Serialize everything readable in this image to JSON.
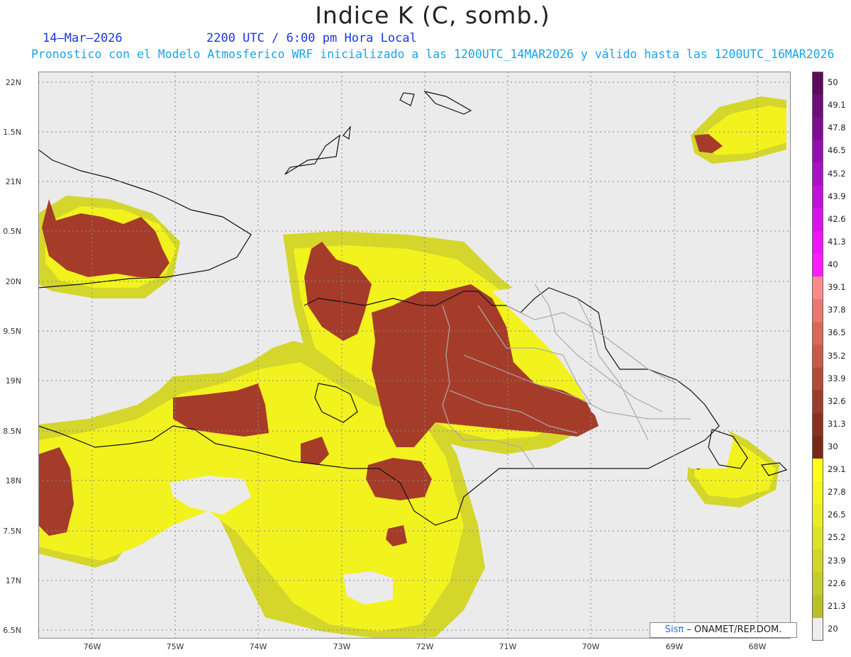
{
  "header": {
    "title": "Indice K (C, somb.)",
    "date": "14–Mar–2026",
    "time_label": "2200 UTC / 6:00 pm Hora Local",
    "subtitle": "Pronostico con el Modelo Atmosferico WRF inicializado a las 1200UTC_14MAR2026 y válido hasta las  1200UTC_16MAR2026"
  },
  "lat_labels": [
    "22N",
    "1.5N",
    "21N",
    "0.5N",
    "20N",
    "9.5N",
    "19N",
    "8.5N",
    "18N",
    "7.5N",
    "17N",
    "6.5N"
  ],
  "lon_labels": [
    "76W",
    "75W",
    "74W",
    "73W",
    "72W",
    "71W",
    "70W",
    "69W",
    "68W"
  ],
  "colorbar": {
    "labels": [
      "50",
      "49.1",
      "47.8",
      "46.5",
      "45.2",
      "43.9",
      "42.6",
      "41.3",
      "40",
      "39.1",
      "37.8",
      "36.5",
      "35.2",
      "33.9",
      "32.6",
      "31.3",
      "30",
      "29.1",
      "27.8",
      "26.5",
      "25.2",
      "23.9",
      "22.6",
      "21.3",
      "20"
    ],
    "colors": [
      "#5c0a5c",
      "#6e0c78",
      "#800c94",
      "#950fb0",
      "#a810c8",
      "#c010dc",
      "#d812ec",
      "#ee14fa",
      "#ff1aff",
      "#f88a8a",
      "#e87870",
      "#d86858",
      "#c85a48",
      "#b24a38",
      "#9e3c2c",
      "#8a3020",
      "#7a2818",
      "#ffff1a",
      "#f4f420",
      "#e8ec24",
      "#dce226",
      "#d0d628",
      "#c4cc28",
      "#b8c026",
      "#eeeeee"
    ]
  },
  "credit": {
    "brand": "Sisπ",
    "org": "– ONAMET/REP.DOM."
  }
}
